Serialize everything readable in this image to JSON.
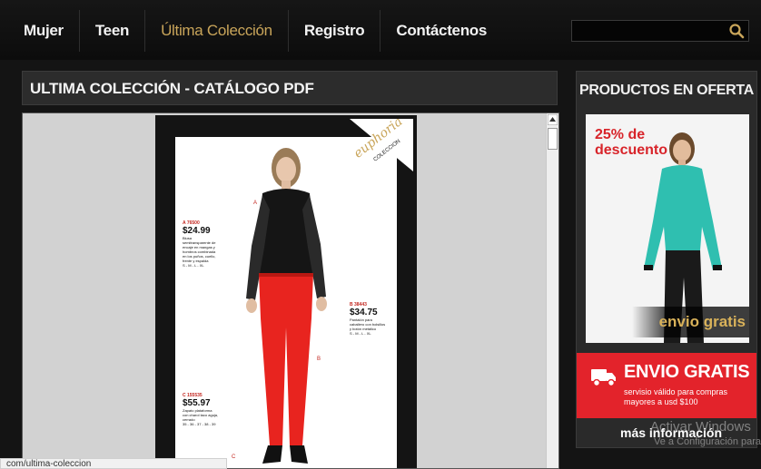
{
  "nav": {
    "items": [
      {
        "label": "Mujer"
      },
      {
        "label": "Teen"
      },
      {
        "label": "Última Colección",
        "active": true
      },
      {
        "label": "Registro"
      },
      {
        "label": "Contáctenos"
      }
    ],
    "search_placeholder": ""
  },
  "main": {
    "title": "ULTIMA COLECCIÓN - CATÁLOGO PDF",
    "pdf": {
      "brand": "euphoria",
      "brand_sub": "COLECCION",
      "item_a": {
        "marker": "A",
        "code": "A 76500",
        "price": "$24.99",
        "text": "Blusa semitransparente de encaje en mangas y hombros combinada en los puños, cuello, frente y espalda",
        "sizes": "S - M - L - XL"
      },
      "item_b": {
        "marker": "B",
        "code": "B 38443",
        "price": "$34.75",
        "text": "Pantalón para caballero con bolsillos y botón metálico",
        "sizes": "S - M - L - XL"
      },
      "item_c": {
        "marker": "C",
        "code": "C 155535",
        "price": "$55.97",
        "text": "Zapato plataforma con charol taco aguja, cerrado",
        "sizes": "35 - 36 - 37 - 38 - 39"
      }
    }
  },
  "status_url": "com/ultima-coleccion",
  "sidebar": {
    "title": "PRODUCTOS EN OFERTA",
    "promo": {
      "discount_line1": "25% de",
      "discount_line2": "descuento",
      "shipping_label": "envio gratis"
    },
    "shipping": {
      "title": "ENVIO GRATIS",
      "text": "servisio válido para compras mayores a usd $100"
    },
    "more_info": "más información"
  },
  "watermark": {
    "line1": "Activar Windows",
    "line2": "Ve a Configuración para"
  },
  "colors": {
    "accent_gold": "#c9a55a",
    "promo_red": "#e3232b",
    "discount_red": "#d8242a",
    "background": "#141414"
  }
}
